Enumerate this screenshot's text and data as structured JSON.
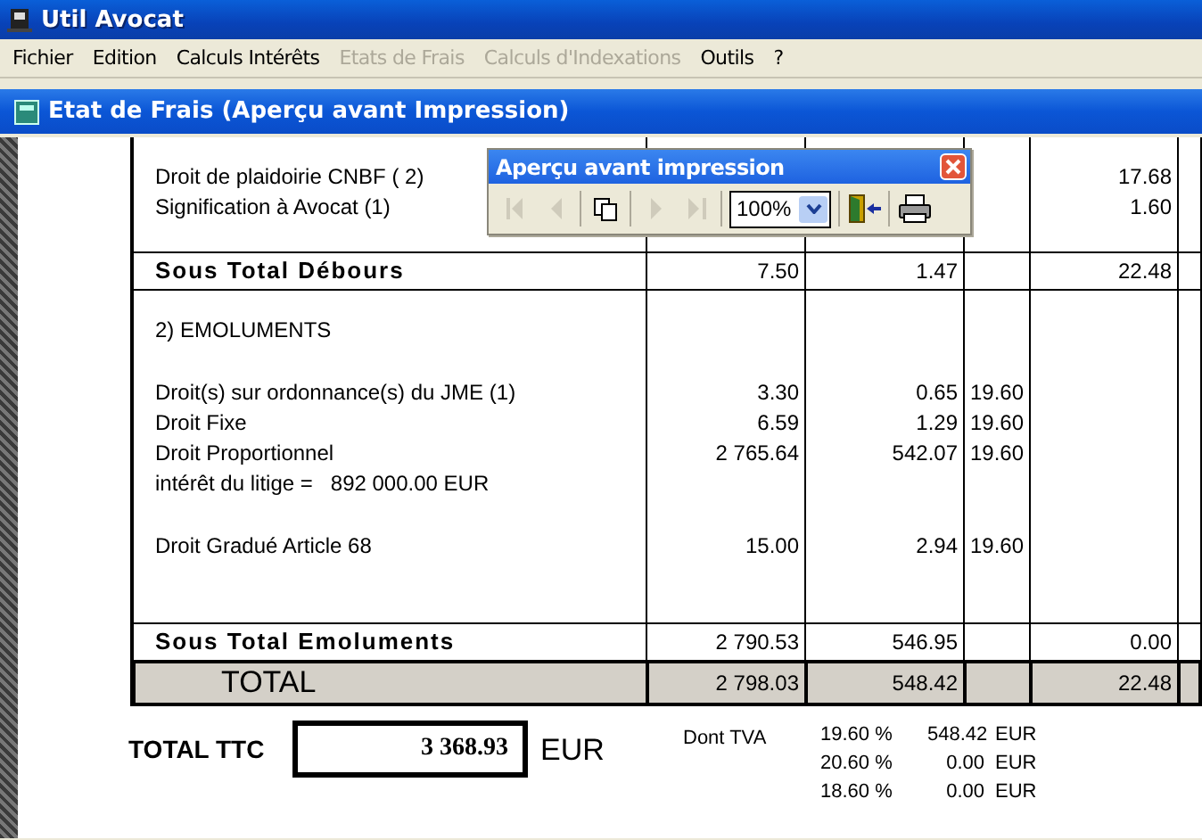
{
  "window": {
    "title": "Util Avocat"
  },
  "menu": [
    {
      "label": "Fichier",
      "disabled": false
    },
    {
      "label": "Edition",
      "disabled": false
    },
    {
      "label": "Calculs Intérêts",
      "disabled": false
    },
    {
      "label": "Etats de Frais",
      "disabled": true
    },
    {
      "label": "Calculs d'Indexations",
      "disabled": true
    },
    {
      "label": "Outils",
      "disabled": false
    },
    {
      "label": "?",
      "disabled": false
    }
  ],
  "document_window": {
    "title": "Etat de Frais (Aperçu avant Impression)"
  },
  "preview_toolbar": {
    "title": "Aperçu avant impression",
    "zoom": "100%",
    "buttons": [
      {
        "kind": "first",
        "disabled": true
      },
      {
        "kind": "previous",
        "disabled": true
      },
      {
        "kind": "pages",
        "disabled": false
      },
      {
        "kind": "next",
        "disabled": true
      },
      {
        "kind": "last",
        "disabled": true
      },
      {
        "kind": "zoom",
        "disabled": false
      },
      {
        "kind": "exit",
        "disabled": false
      },
      {
        "kind": "print",
        "disabled": false
      }
    ]
  },
  "table": {
    "sections": [
      {
        "kind": "block",
        "groups": [
          [
            {
              "kind": "item",
              "label": "Droit de plaidoirie CNBF ( 2)",
              "column_5": "17.68"
            },
            {
              "kind": "item",
              "label": "Signification à Avocat (1)",
              "column_5": "1.60"
            }
          ]
        ]
      },
      {
        "kind": "subtotal",
        "label": "Sous Total Débours",
        "column_2": "7.50",
        "column_3": "1.47",
        "column_5": "22.48"
      },
      {
        "kind": "block",
        "heading": "2) EMOLUMENTS",
        "groups": [
          [
            {
              "kind": "item",
              "label": "Droit(s) sur ordonnance(s) du JME (1)",
              "column_2": "3.30",
              "column_3": "0.65",
              "column_4": "19.60"
            },
            {
              "kind": "item",
              "label": "Droit Fixe",
              "column_2": "6.59",
              "column_3": "1.29",
              "column_4": "19.60"
            },
            {
              "kind": "item",
              "label": "Droit Proportionnel",
              "column_2": "2 765.64",
              "column_3": "542.07",
              "column_4": "19.60"
            },
            {
              "kind": "note",
              "label": "intérêt du litige =",
              "value": "892 000.00 EUR"
            }
          ],
          [
            {
              "kind": "item",
              "label": "Droit Gradué Article 68",
              "column_2": "15.00",
              "column_3": "2.94",
              "column_4": "19.60"
            }
          ]
        ]
      },
      {
        "kind": "subtotal",
        "label": "Sous Total Emoluments",
        "column_2": "2 790.53",
        "column_3": "546.95",
        "column_5": "0.00"
      },
      {
        "kind": "total",
        "label": "TOTAL",
        "column_2": "2 798.03",
        "column_3": "548.42",
        "column_5": "22.48"
      }
    ]
  },
  "total_ttc": {
    "label": "TOTAL TTC",
    "value": "3 368.93",
    "currency": "EUR"
  },
  "vat": {
    "label": "Dont TVA",
    "rows": [
      {
        "rate": "19.60 %",
        "amount": "548.42",
        "currency": "EUR"
      },
      {
        "rate": "20.60 %",
        "amount": "0.00",
        "currency": "EUR"
      },
      {
        "rate": "18.60 %",
        "amount": "0.00",
        "currency": "EUR"
      }
    ]
  }
}
